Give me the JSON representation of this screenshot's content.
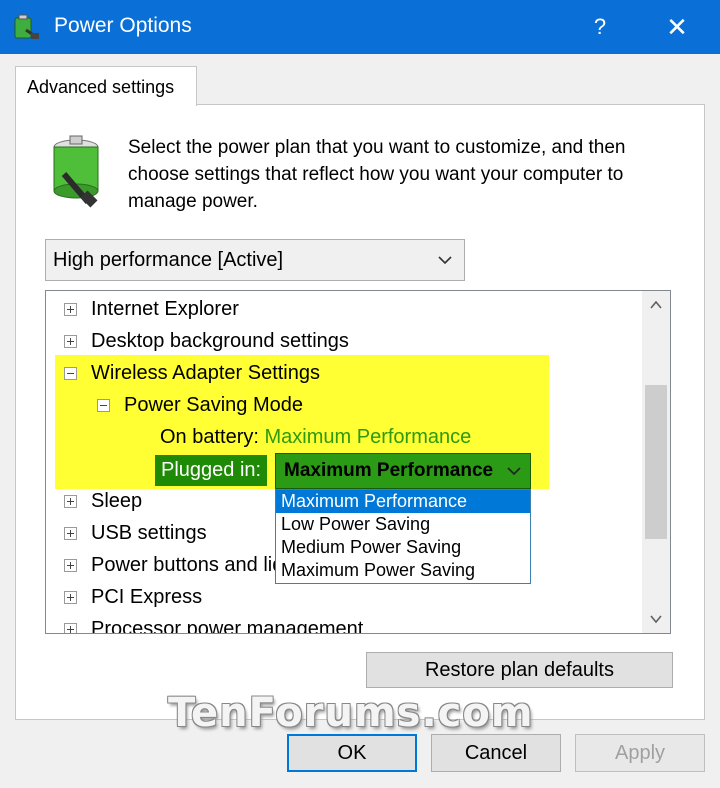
{
  "window": {
    "title": "Power Options",
    "help_glyph": "?",
    "close_glyph": "✕"
  },
  "tab": {
    "label": "Advanced settings"
  },
  "description": "Select the power plan that you want to customize, and then choose settings that reflect how you want your computer to manage power.",
  "plan_select": {
    "value": "High performance [Active]"
  },
  "tree": {
    "items": [
      {
        "label": "Internet Explorer"
      },
      {
        "label": "Desktop background settings"
      },
      {
        "label": "Wireless Adapter Settings"
      },
      {
        "label": "Power Saving Mode"
      },
      {
        "label": "On battery:",
        "value": "Maximum Performance"
      },
      {
        "label": "Plugged in:",
        "value": "Maximum Performance"
      },
      {
        "label": "Sleep"
      },
      {
        "label": "USB settings"
      },
      {
        "label": "Power buttons and lid"
      },
      {
        "label": "PCI Express"
      },
      {
        "label": "Processor power management"
      }
    ],
    "dropdown_options": [
      "Maximum Performance",
      "Low Power Saving",
      "Medium Power Saving",
      "Maximum Power Saving"
    ],
    "selected_option": "Maximum Performance"
  },
  "buttons": {
    "restore": "Restore plan defaults",
    "ok": "OK",
    "cancel": "Cancel",
    "apply": "Apply"
  },
  "watermark": "TenForums.com",
  "colors": {
    "titlebar": "#0a6fd6",
    "highlight": "#ffff33",
    "value_green": "#2e9a0e",
    "selection": "#0078d7"
  }
}
